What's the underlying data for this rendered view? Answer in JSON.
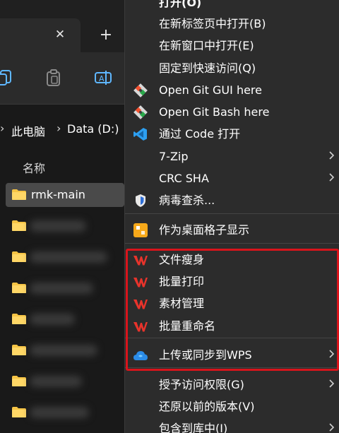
{
  "explorer": {
    "tab_close_glyph": "✕",
    "tab_new_glyph": "+",
    "toolbar": {
      "copy_icon": "copy-icon",
      "paste_icon": "paste-icon",
      "rename_icon": "rename-icon"
    },
    "breadcrumb": {
      "separator": "›",
      "this_pc": "此电脑",
      "drive": "Data (D:)"
    },
    "column_header": "名称",
    "files": [
      {
        "name": "rmk-main",
        "selected": true
      },
      {
        "name": "",
        "selected": false
      },
      {
        "name": "",
        "selected": false
      },
      {
        "name": "",
        "selected": false
      },
      {
        "name": "",
        "selected": false
      },
      {
        "name": "",
        "selected": false
      },
      {
        "name": "",
        "selected": false
      },
      {
        "name": "",
        "selected": false
      }
    ],
    "folder_color": "#f6c445"
  },
  "context_menu": {
    "top_partial_label": "打开(O)",
    "items": [
      {
        "label": "在新标签页中打开(B)",
        "icon": ""
      },
      {
        "label": "在新窗口中打开(E)",
        "icon": ""
      },
      {
        "label": "固定到快速访问(Q)",
        "icon": ""
      },
      {
        "label": "Open Git GUI here",
        "icon": "git-icon"
      },
      {
        "label": "Open Git Bash here",
        "icon": "git-icon"
      },
      {
        "label": "通过 Code 打开",
        "icon": "vscode-icon"
      },
      {
        "label": "7-Zip",
        "icon": "",
        "submenu": true
      },
      {
        "label": "CRC SHA",
        "icon": "",
        "submenu": true
      },
      {
        "label": "病毒查杀...",
        "icon": "antivirus-shield-icon"
      },
      {
        "label": "作为桌面格子显示",
        "icon": "desktop-grid-icon"
      },
      {
        "label": "文件瘦身",
        "icon": "wps-icon"
      },
      {
        "label": "批量打印",
        "icon": "wps-icon"
      },
      {
        "label": "素材管理",
        "icon": "wps-icon"
      },
      {
        "label": "批量重命名",
        "icon": "wps-icon"
      },
      {
        "label": "上传或同步到WPS",
        "icon": "wps-cloud-icon",
        "submenu": true
      },
      {
        "label": "授予访问权限(G)",
        "icon": "",
        "submenu": true
      },
      {
        "label": "还原以前的版本(V)",
        "icon": ""
      },
      {
        "label": "包含到库中(I)",
        "icon": "",
        "submenu": true
      }
    ],
    "highlight_color": "#d9141b",
    "wps_color": "#e8332b",
    "vscode_color": "#2d9ff0"
  }
}
